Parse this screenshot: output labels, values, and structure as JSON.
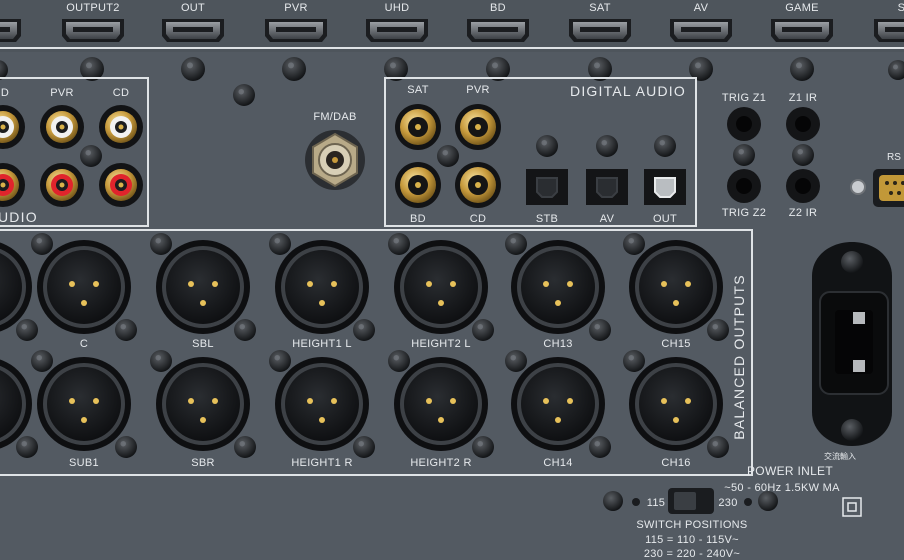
{
  "hdmi_labels": [
    "OUTPUT2",
    "OUT",
    "PVR",
    "UHD",
    "BD",
    "SAT",
    "AV",
    "GAME",
    "ST"
  ],
  "analog": {
    "labels_top": [
      "D",
      "PVR",
      "CD"
    ],
    "section_label": "UDIO"
  },
  "fm_dab": {
    "label": "FM/DAB"
  },
  "digital_audio": {
    "title": "DIGITAL AUDIO",
    "coax_top": [
      "SAT",
      "PVR"
    ],
    "coax_bottom": [
      "BD",
      "CD"
    ],
    "optical": [
      "STB",
      "AV",
      "OUT"
    ]
  },
  "triggers": {
    "trig_z1": "TRIG Z1",
    "z1_ir": "Z1 IR",
    "trig_z2": "TRIG Z2",
    "z2_ir": "Z2 IR"
  },
  "rs_label": "RS",
  "balanced": {
    "title": "BALANCED OUTPUTS",
    "row1": [
      "C",
      "SBL",
      "HEIGHT1 L",
      "HEIGHT2 L",
      "CH13",
      "CH15"
    ],
    "row2": [
      "SUB1",
      "SBR",
      "HEIGHT1 R",
      "HEIGHT2 R",
      "CH14",
      "CH16"
    ]
  },
  "power": {
    "jp_label": "交流輸入",
    "inlet_label": "POWER INLET",
    "rating": "~50 - 60Hz 1.5KW MA"
  },
  "voltage_switch": {
    "left": "115",
    "right": "230",
    "title": "SWITCH POSITIONS",
    "line1": "115 = 110 - 115V~",
    "line2": "230 = 220 - 240V~"
  }
}
